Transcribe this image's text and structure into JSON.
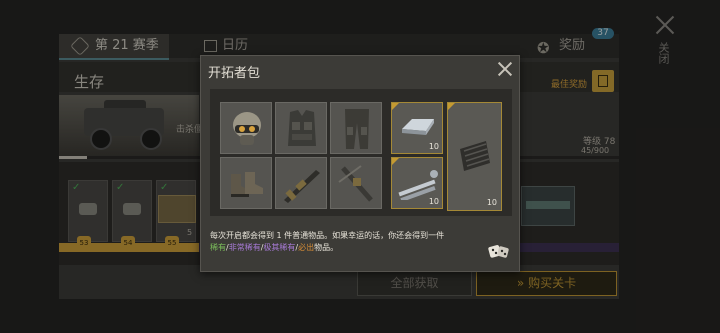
{
  "side": {
    "close_label": "关闭"
  },
  "season_tabs": {
    "season_label": "第 21 赛季",
    "calendar_label": "日历",
    "reward_label": "奖励",
    "reward_badge": "37"
  },
  "season_panel": {
    "section_title": "生存",
    "best_reward_label": "最佳奖励",
    "kill_text": "击杀僵",
    "level_text": "等级 78",
    "progress_text": "45/900",
    "progress_fraction": 0.05,
    "card_levels": [
      "53",
      "54",
      "55"
    ],
    "card_count": "5"
  },
  "buttons": {
    "get_all": "全部获取",
    "buy_pass": "购买关卡"
  },
  "modal": {
    "title": "开拓者包",
    "slots": [
      {
        "name": "helmet",
        "qty": ""
      },
      {
        "name": "vest",
        "qty": ""
      },
      {
        "name": "pants",
        "qty": ""
      },
      {
        "name": "metal-ingot",
        "qty": "10"
      },
      {
        "name": "boots",
        "qty": ""
      },
      {
        "name": "rifle",
        "qty": ""
      },
      {
        "name": "crossbow",
        "qty": ""
      },
      {
        "name": "pipes",
        "qty": "10"
      },
      {
        "name": "sheet-metal",
        "qty": "10"
      }
    ],
    "desc_line1": "每次开启都会得到 1 件普通物品。如果幸运的话，你还会得到一件",
    "desc_rare": "稀有",
    "desc_sep": "/",
    "desc_very_rare": "非常稀有",
    "desc_extremely_rare": "极其稀有",
    "desc_must": "必出",
    "desc_tail": "物品。",
    "colors": {
      "rare": "#7cbf5b",
      "very_rare": "#a77ad6",
      "extremely_rare": "#a77ad6",
      "must": "#d28a36"
    }
  }
}
